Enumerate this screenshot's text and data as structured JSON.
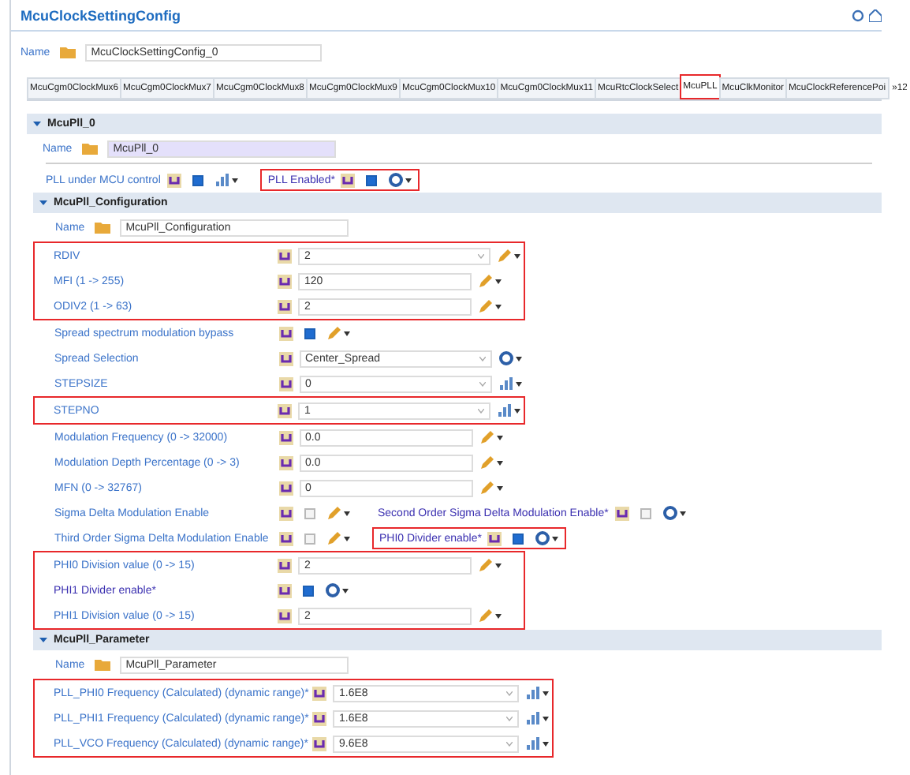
{
  "window": {
    "title": "McuClockSettingConfig"
  },
  "name_field": {
    "label": "Name",
    "value": "McuClockSettingConfig_0"
  },
  "tabs": [
    {
      "label": "McuCgm0ClockMux6",
      "selected": false,
      "highlighted": false
    },
    {
      "label": "McuCgm0ClockMux7",
      "selected": false,
      "highlighted": false
    },
    {
      "label": "McuCgm0ClockMux8",
      "selected": false,
      "highlighted": false
    },
    {
      "label": "McuCgm0ClockMux9",
      "selected": false,
      "highlighted": false
    },
    {
      "label": "McuCgm0ClockMux10",
      "selected": false,
      "highlighted": false
    },
    {
      "label": "McuCgm0ClockMux11",
      "selected": false,
      "highlighted": false
    },
    {
      "label": "McuRtcClockSelect",
      "selected": false,
      "highlighted": false
    },
    {
      "label": "McuPLL",
      "selected": true,
      "highlighted": true
    },
    {
      "label": "McuClkMonitor",
      "selected": false,
      "highlighted": false
    },
    {
      "label": "McuClockReferencePoi",
      "selected": false,
      "highlighted": false
    }
  ],
  "tab_overflow": "»12",
  "pll": {
    "title": "McuPll_0",
    "expanded": true,
    "name": {
      "label": "Name",
      "value": "McuPll_0",
      "focused": true
    },
    "switches": [
      {
        "label": "PLL under MCU control",
        "checked": true,
        "action": {
          "kind": "chart"
        },
        "highlighted": false
      },
      {
        "label": "PLL Enabled*",
        "checked": true,
        "action": {
          "kind": "link"
        },
        "highlighted": true
      }
    ],
    "sections": [
      {
        "title": "McuPll_Configuration",
        "expanded": true,
        "name": {
          "label": "Name",
          "value": "McuPll_Configuration",
          "focused": false
        },
        "wide": false,
        "rows": [
          {
            "label": "RDIV",
            "kind": "combo",
            "value": "2",
            "action": {
              "kind": "pencil"
            },
            "highlighted": true
          },
          {
            "label": "MFI (1 -> 255)",
            "kind": "text",
            "value": "120",
            "action": {
              "kind": "pencil"
            },
            "highlighted": true
          },
          {
            "label": "ODIV2 (1 -> 63)",
            "kind": "text",
            "value": "2",
            "action": {
              "kind": "pencil"
            },
            "highlighted": true
          },
          {
            "label": "Spread spectrum modulation bypass",
            "kind": "checkbox",
            "checked": true,
            "action": {
              "kind": "pencil"
            },
            "highlighted": false
          },
          {
            "label": "Spread Selection",
            "kind": "combo",
            "value": "Center_Spread",
            "action": {
              "kind": "link"
            },
            "highlighted": false
          },
          {
            "label": "STEPSIZE",
            "kind": "combo",
            "value": "0",
            "action": {
              "kind": "chart"
            },
            "highlighted": false
          },
          {
            "label": "STEPNO",
            "kind": "combo",
            "value": "1",
            "action": {
              "kind": "chart"
            },
            "highlighted": true
          },
          {
            "label": "Modulation Frequency (0 -> 32000)",
            "kind": "text",
            "value": "0.0",
            "action": {
              "kind": "pencil"
            },
            "highlighted": false
          },
          {
            "label": "Modulation Depth Percentage (0 -> 3)",
            "kind": "text",
            "value": "0.0",
            "action": {
              "kind": "pencil"
            },
            "highlighted": false
          },
          {
            "label": "MFN (0 -> 32767)",
            "kind": "text",
            "value": "0",
            "action": {
              "kind": "pencil"
            },
            "highlighted": false
          },
          {
            "label": "Sigma Delta Modulation Enable",
            "kind": "checkbox",
            "checked": false,
            "action": {
              "kind": "pencil"
            },
            "highlighted": false,
            "side": {
              "label": "Second Order Sigma Delta Modulation Enable*",
              "checked": false,
              "action": {
                "kind": "link"
              },
              "highlighted": false
            }
          },
          {
            "label": "Third Order Sigma Delta Modulation Enable",
            "kind": "checkbox",
            "checked": false,
            "action": {
              "kind": "pencil"
            },
            "highlighted": false,
            "side": {
              "label": "PHI0 Divider enable*",
              "checked": true,
              "action": {
                "kind": "link"
              },
              "highlighted": true
            }
          },
          {
            "label": "PHI0 Division value (0 -> 15)",
            "kind": "text",
            "value": "2",
            "action": {
              "kind": "pencil"
            },
            "highlighted": true
          },
          {
            "label": "PHI1 Divider enable*",
            "kind": "checkbox",
            "checked": true,
            "action": {
              "kind": "link"
            },
            "highlighted": true
          },
          {
            "label": "PHI1 Division value (0 -> 15)",
            "kind": "text",
            "value": "2",
            "action": {
              "kind": "pencil"
            },
            "highlighted": true
          }
        ]
      },
      {
        "title": "McuPll_Parameter",
        "expanded": true,
        "name": {
          "label": "Name",
          "value": "McuPll_Parameter",
          "focused": false
        },
        "wide": true,
        "rows": [
          {
            "label": "PLL_PHI0 Frequency (Calculated) (dynamic range)*",
            "kind": "combo",
            "value": "1.6E8",
            "action": {
              "kind": "chart"
            },
            "highlighted": true
          },
          {
            "label": "PLL_PHI1 Frequency (Calculated) (dynamic range)*",
            "kind": "combo",
            "value": "1.6E8",
            "action": {
              "kind": "chart"
            },
            "highlighted": true
          },
          {
            "label": "PLL_VCO Frequency (Calculated) (dynamic range)*",
            "kind": "combo",
            "value": "9.6E8",
            "action": {
              "kind": "chart"
            },
            "highlighted": true
          }
        ]
      }
    ]
  }
}
